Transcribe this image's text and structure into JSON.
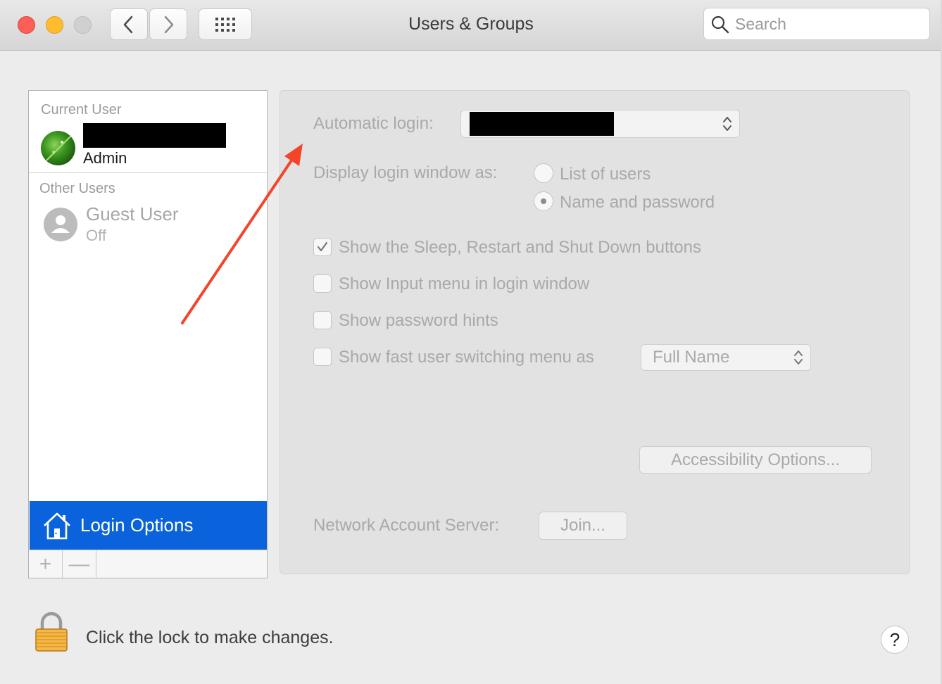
{
  "window": {
    "title": "Users & Groups"
  },
  "toolbar": {
    "back_icon": "chevron-left-icon",
    "forward_icon": "chevron-right-icon",
    "grid_icon": "grid-icon"
  },
  "search": {
    "placeholder": "Search"
  },
  "sidebar": {
    "current_user_header": "Current User",
    "current_user_role": "Admin",
    "other_users_header": "Other Users",
    "guest": {
      "name": "Guest User",
      "status": "Off"
    },
    "login_options_label": "Login Options",
    "add_symbol": "+",
    "remove_symbol": "—"
  },
  "login_panel": {
    "automatic_login_label": "Automatic login:",
    "display_login_label": "Display login window as:",
    "radio_options": [
      {
        "label": "List of users",
        "selected": false
      },
      {
        "label": "Name and password",
        "selected": true
      }
    ],
    "checkboxes": [
      {
        "label": "Show the Sleep, Restart and Shut Down buttons",
        "checked": true
      },
      {
        "label": "Show Input menu in login window",
        "checked": false
      },
      {
        "label": "Show password hints",
        "checked": false
      },
      {
        "label": "Show fast user switching menu as",
        "checked": false
      }
    ],
    "fast_switching_value": "Full Name",
    "accessibility_button": "Accessibility Options...",
    "network_server_label": "Network Account Server:",
    "join_button": "Join..."
  },
  "footer": {
    "lock_text": "Click the lock to make changes.",
    "help_symbol": "?"
  },
  "colors": {
    "selection": "#0a63dc",
    "annotation_arrow": "#f4452b"
  }
}
